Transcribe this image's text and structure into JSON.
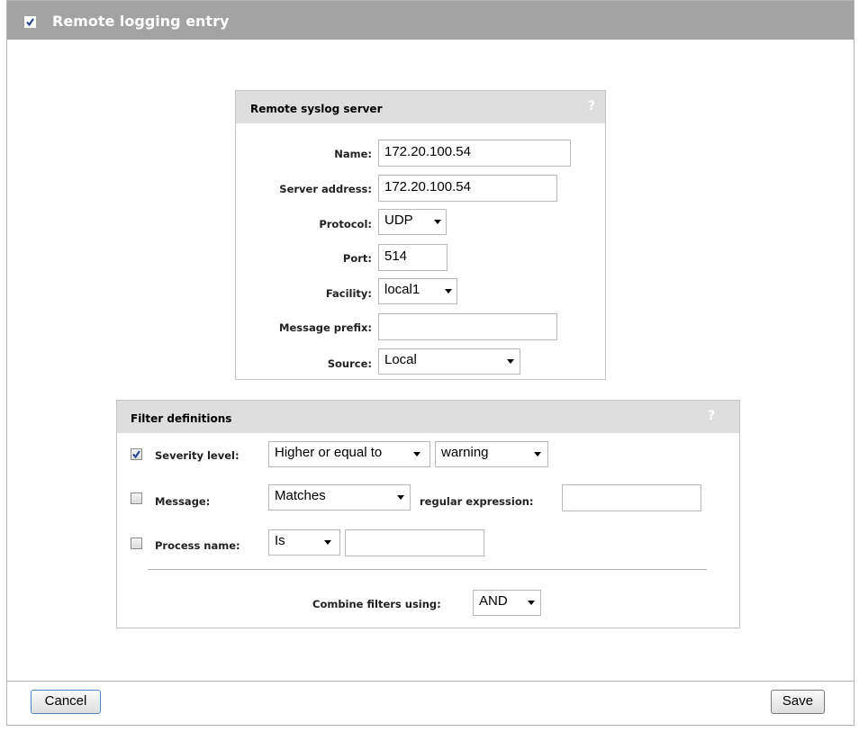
{
  "header": {
    "title": "Remote logging entry",
    "enabled": true
  },
  "syslog_panel": {
    "title": "Remote syslog server",
    "help": "?",
    "name": {
      "label": "Name:",
      "value": "172.20.100.54"
    },
    "server_address": {
      "label": "Server address:",
      "value": "172.20.100.54"
    },
    "protocol": {
      "label": "Protocol:",
      "value": "UDP"
    },
    "port": {
      "label": "Port:",
      "value": "514"
    },
    "facility": {
      "label": "Facility:",
      "value": "local1"
    },
    "message_prefix": {
      "label": "Message prefix:",
      "value": ""
    },
    "source": {
      "label": "Source:",
      "value": "Local"
    }
  },
  "filter_panel": {
    "title": "Filter definitions",
    "help": "?",
    "severity": {
      "label": "Severity level:",
      "checked": true,
      "operator": "Higher or equal to",
      "value": "warning"
    },
    "message": {
      "label": "Message:",
      "checked": false,
      "operator": "Matches",
      "regex_label": "regular expression:",
      "value": ""
    },
    "process": {
      "label": "Process name:",
      "checked": false,
      "operator": "Is",
      "value": ""
    },
    "combine": {
      "label": "Combine filters using:",
      "value": "AND"
    }
  },
  "footer": {
    "cancel_label": "Cancel",
    "save_label": "Save"
  },
  "icons": {
    "checkbox": "checkbox-icon",
    "dropdown": "chevron-down-icon",
    "help": "help-icon"
  },
  "colors": {
    "titlebar": "#a3a3a3",
    "panel_header": "#dedede",
    "check_mark": "#1f3f8f"
  }
}
